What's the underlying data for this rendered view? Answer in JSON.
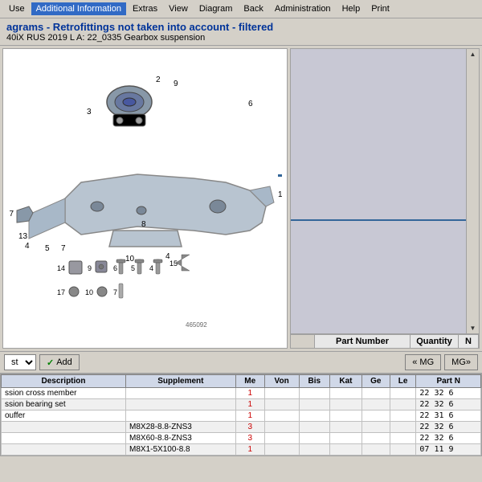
{
  "menu": {
    "items": [
      {
        "label": "Use",
        "active": false
      },
      {
        "label": "Additional Information",
        "active": true
      },
      {
        "label": "Extras",
        "active": false
      },
      {
        "label": "View",
        "active": false
      },
      {
        "label": "Diagram",
        "active": false
      },
      {
        "label": "Back",
        "active": false
      },
      {
        "label": "Administration",
        "active": false
      },
      {
        "label": "Help",
        "active": false
      },
      {
        "label": "Print",
        "active": false
      }
    ]
  },
  "title": {
    "main": "agrams - Retrofittings not taken into account - filtered",
    "sub": "40iX RUS 2019  L A: 22_0335 Gearbox suspension"
  },
  "diagram": {
    "part_number_label": "465092"
  },
  "parts_table_header": {
    "empty": "",
    "part_number": "Part Number",
    "quantity": "Quantity",
    "n": "N"
  },
  "toolbar": {
    "select_value": "st",
    "add_label": "Add",
    "mg_left": "« MG",
    "mg_right": "MG»"
  },
  "data_table": {
    "columns": [
      "Description",
      "Supplement",
      "Me",
      "Von",
      "Bis",
      "Kat",
      "Ge",
      "Le",
      "Part N"
    ],
    "rows": [
      {
        "description": "ssion cross member",
        "supplement": "",
        "me": "1",
        "von": "",
        "bis": "",
        "kat": "",
        "ge": "",
        "le": "",
        "part_n": "22 32 6 "
      },
      {
        "description": "ssion bearing set",
        "supplement": "",
        "me": "1",
        "von": "",
        "bis": "",
        "kat": "",
        "ge": "",
        "le": "",
        "part_n": "22 32 6 "
      },
      {
        "description": "ouffer",
        "supplement": "",
        "me": "1",
        "von": "",
        "bis": "",
        "kat": "",
        "ge": "",
        "le": "",
        "part_n": "22 31 6 "
      },
      {
        "description": "",
        "supplement": "M8X28-8.8-ZNS3",
        "me": "3",
        "von": "",
        "bis": "",
        "kat": "",
        "ge": "",
        "le": "",
        "part_n": "22 32 6 "
      },
      {
        "description": "",
        "supplement": "M8X60-8.8-ZNS3",
        "me": "3",
        "von": "",
        "bis": "",
        "kat": "",
        "ge": "",
        "le": "",
        "part_n": "22 32 6 "
      },
      {
        "description": "",
        "supplement": "M8X1-5X100-8.8",
        "me": "1",
        "von": "",
        "bis": "",
        "kat": "",
        "ge": "",
        "le": "",
        "part_n": "07 11 9 "
      }
    ]
  }
}
